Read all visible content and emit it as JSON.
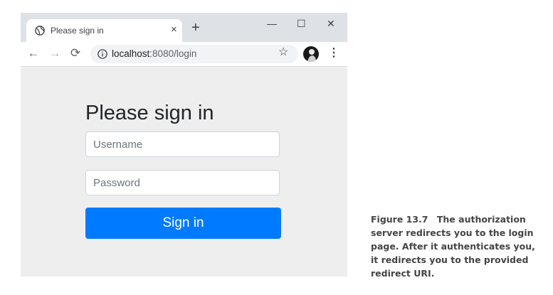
{
  "browser": {
    "tab_title": "Please sign in",
    "tab_close": "×",
    "new_tab": "+",
    "window_controls": {
      "minimize": "—",
      "maximize": "☐",
      "close": "✕"
    },
    "nav": {
      "back": "←",
      "forward": "→",
      "reload": "⟳"
    },
    "url_host": "localhost",
    "url_rest": ":8080/login",
    "bookmark": "☆",
    "menu": "⋮"
  },
  "form": {
    "heading": "Please sign in",
    "username_placeholder": "Username",
    "password_placeholder": "Password",
    "submit_label": "Sign in"
  },
  "caption": {
    "label": "Figure 13.7",
    "text": "The authorization server redirects you to the login page. After it authenticates you, it redirects you to the provided redirect URI."
  },
  "colors": {
    "primary": "#007bff",
    "page_bg": "#eeeeee",
    "tabstrip": "#dee1e6"
  },
  "icons": [
    "globe-icon",
    "info-icon",
    "star-icon",
    "back-arrow-icon",
    "forward-arrow-icon",
    "reload-icon",
    "kebab-menu-icon"
  ]
}
